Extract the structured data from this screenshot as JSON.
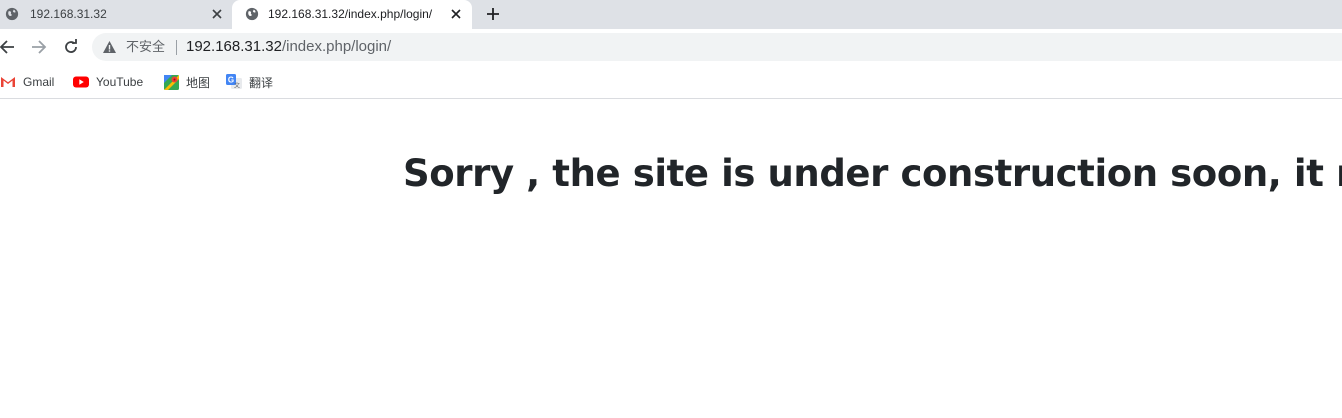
{
  "tabs": [
    {
      "title": "192.168.31.32",
      "favicon": "globe-icon",
      "active": false
    },
    {
      "title": "192.168.31.32/index.php/login/",
      "favicon": "globe-icon",
      "active": true
    }
  ],
  "toolbar": {
    "security_label": "不安全",
    "url_host": "192.168.31.32",
    "url_path": "/index.php/login/"
  },
  "bookmarks": [
    {
      "label": "Gmail",
      "icon": "gmail-icon"
    },
    {
      "label": "YouTube",
      "icon": "youtube-icon"
    },
    {
      "label": "地图",
      "icon": "maps-icon"
    },
    {
      "label": "翻译",
      "icon": "translate-icon"
    }
  ],
  "page": {
    "heading": "Sorry , the site is under construction soon, it run"
  },
  "colors": {
    "tabstrip_bg": "#dee1e6",
    "omnibox_bg": "#f1f3f4",
    "heading_text": "#212529",
    "youtube_red": "#ff0000",
    "gmail_red": "#ea4335"
  }
}
